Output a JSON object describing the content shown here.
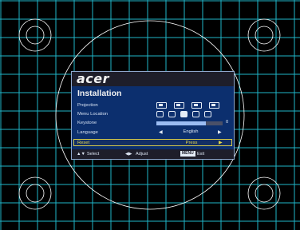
{
  "osd": {
    "brand": "acer",
    "title": "Installation",
    "rows": {
      "projection": "Projection",
      "menu_location": "Menu Location",
      "keystone": "Keystone",
      "language": "Language",
      "reset": "Reset"
    },
    "keystone_value": "0",
    "keystone_level_percent": 75,
    "language_value": "English",
    "reset_value": "Press",
    "footer": {
      "select": "Select",
      "adjust": "Adjust",
      "menu_key": "MENU",
      "exit": "Exit"
    }
  },
  "colors": {
    "background": "#000000",
    "grid": "#1fb6c9",
    "circles": "#ffffff",
    "osd_panel": "#0c2f6e",
    "osd_header": "#1e1e2a",
    "highlight": "#e5d64a"
  }
}
